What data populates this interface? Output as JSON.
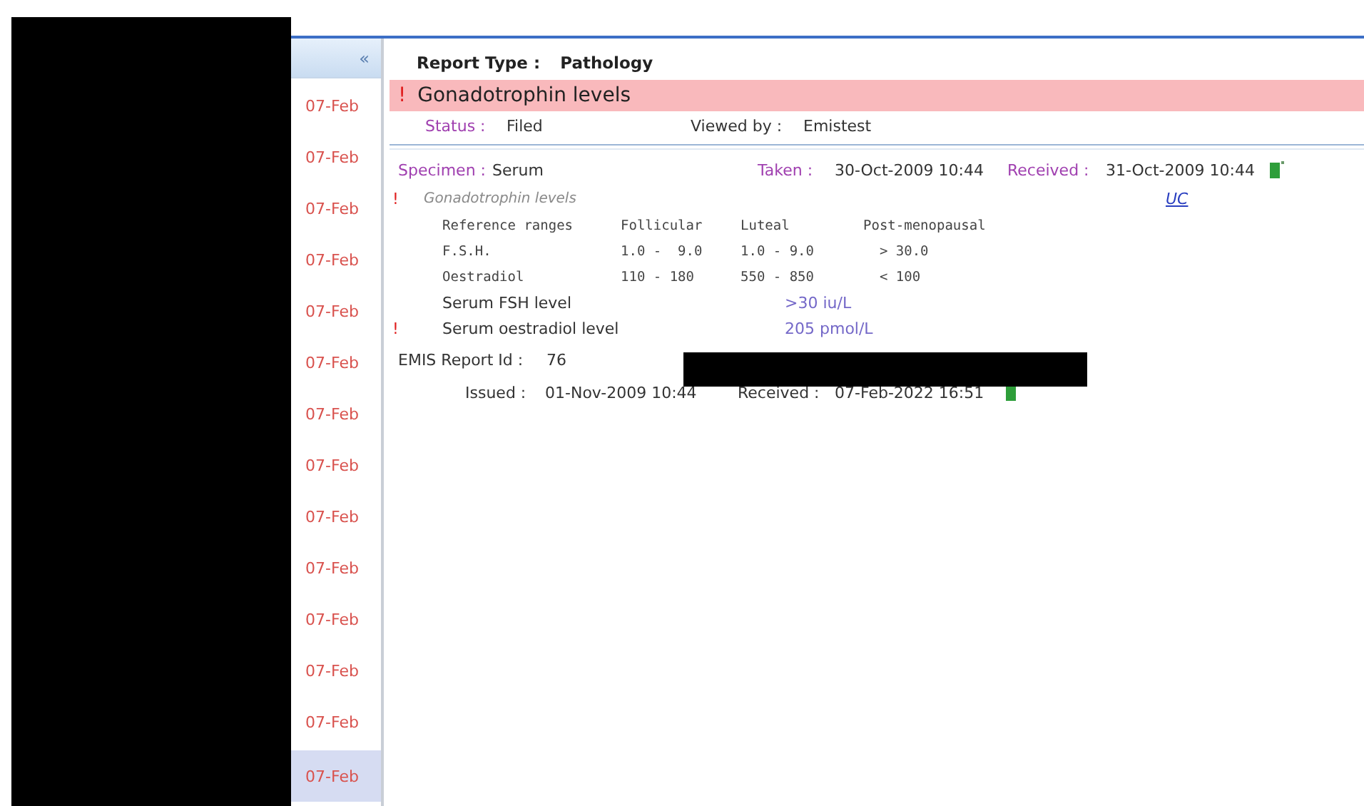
{
  "sidebar": {
    "collapse_glyph": "«",
    "items": [
      {
        "date": "07-Feb",
        "selected": false
      },
      {
        "date": "07-Feb",
        "selected": false
      },
      {
        "date": "07-Feb",
        "selected": false
      },
      {
        "date": "07-Feb",
        "selected": false
      },
      {
        "date": "07-Feb",
        "selected": false
      },
      {
        "date": "07-Feb",
        "selected": false
      },
      {
        "date": "07-Feb",
        "selected": false
      },
      {
        "date": "07-Feb",
        "selected": false
      },
      {
        "date": "07-Feb",
        "selected": false
      },
      {
        "date": "07-Feb",
        "selected": false
      },
      {
        "date": "07-Feb",
        "selected": false
      },
      {
        "date": "07-Feb",
        "selected": false
      },
      {
        "date": "07-Feb",
        "selected": false
      },
      {
        "date": "07-Feb",
        "selected": true
      }
    ]
  },
  "report": {
    "type_label": "Report Type :",
    "type_value": "Pathology",
    "title_mark": "!",
    "title": "Gonadotrophin levels",
    "status_label": "Status :",
    "status_value": "Filed",
    "viewed_label": "Viewed by :",
    "viewed_value": "Emistest",
    "specimen_label": "Specimen :",
    "specimen_value": "Serum",
    "taken_label": "Taken :",
    "taken_value": "30-Oct-2009 10:44",
    "received_label": "Received :",
    "received_value": "31-Oct-2009 10:44",
    "test_mark": "!",
    "test_name": "Gonadotrophin levels",
    "link": "UC",
    "reference_table": [
      [
        "Reference ranges",
        "Follicular",
        "Luteal",
        "Post-menopausal"
      ],
      [
        "F.S.H.",
        "1.0 -  9.0",
        "1.0 - 9.0",
        "  > 30.0"
      ],
      [
        "Oestradiol",
        "110 - 180",
        "550 - 850",
        "  < 100"
      ]
    ],
    "results": [
      {
        "name": "Serum FSH level",
        "value": ">30 iu/L"
      },
      {
        "mark": "!",
        "name": "Serum oestradiol level",
        "value": "205 pmol/L"
      }
    ],
    "id_label": "EMIS Report Id :",
    "id_value": "76",
    "issued_label": "Issued :",
    "issued_value": "01-Nov-2009 10:44",
    "issued_received_label": "Received :",
    "issued_received_value": "07-Feb-2022 16:51"
  }
}
